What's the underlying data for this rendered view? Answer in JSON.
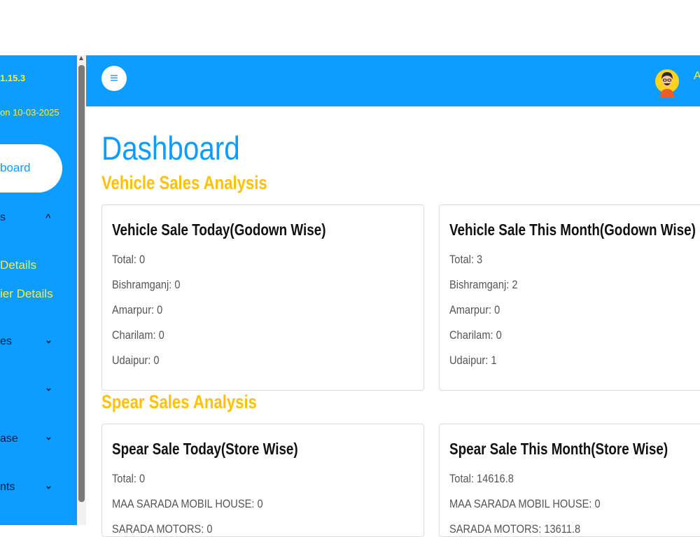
{
  "sidebar": {
    "version": "1.15.3",
    "updated": "on 10-03-2025",
    "active_item": "board",
    "items": [
      {
        "label": "s",
        "chevron": "^"
      },
      {
        "label": "Details"
      },
      {
        "label": "ier Details"
      },
      {
        "label": "es",
        "chevron": "⌄"
      },
      {
        "label": "",
        "chevron": "⌄"
      },
      {
        "label": "ase",
        "chevron": "⌄"
      },
      {
        "label": "nts",
        "chevron": "⌄"
      }
    ]
  },
  "header": {
    "menu_icon": "≡",
    "avatar_icon": "user-avatar",
    "user_initial": "A"
  },
  "main": {
    "title": "Dashboard",
    "vehicle_section": "Vehicle Sales Analysis",
    "spear_section": "Spear Sales Analysis",
    "cards": [
      {
        "title": "Vehicle Sale Today(Godown Wise)",
        "lines": [
          "Total: 0",
          "Bishramganj: 0",
          "Amarpur: 0",
          "Charilam: 0",
          "Udaipur: 0"
        ]
      },
      {
        "title": "Vehicle Sale This Month(Godown Wise)",
        "lines": [
          "Total: 3",
          "Bishramganj: 2",
          "Amarpur: 0",
          "Charilam: 0",
          "Udaipur: 1"
        ]
      },
      {
        "title": "Spear Sale Today(Store Wise)",
        "lines": [
          "Total: 0",
          "MAA SARADA MOBIL HOUSE: 0",
          "SARADA MOTORS: 0"
        ]
      },
      {
        "title": "Spear Sale This Month(Store Wise)",
        "lines": [
          "Total: 14616.8",
          "MAA SARADA MOBIL HOUSE: 0",
          "SARADA MOTORS: 13611.8"
        ]
      }
    ]
  },
  "colors": {
    "primary_blue": "#0d9cff",
    "accent_yellow": "#ffc107",
    "sidebar_yellow": "#ffee33"
  }
}
